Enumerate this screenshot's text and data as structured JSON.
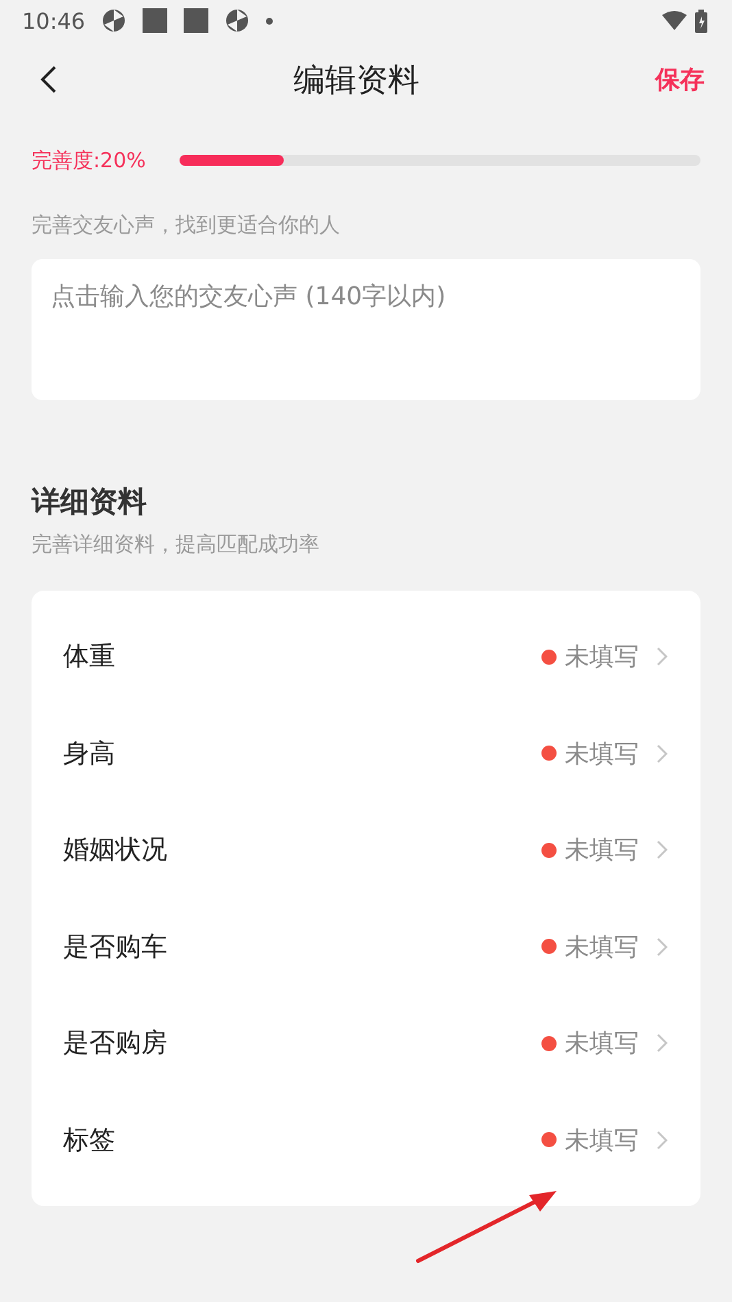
{
  "status_bar": {
    "time": "10:46"
  },
  "header": {
    "title": "编辑资料",
    "action": "保存"
  },
  "completeness": {
    "label": "完善度:20%",
    "level": 0.2
  },
  "intro": {
    "hint": "完善交友心声，找到更适合你的人",
    "placeholder": "点击输入您的交友心声 (140字以内)"
  },
  "details": {
    "title": "详细资料",
    "subtitle": "完善详细资料，提高匹配成功率",
    "items": [
      {
        "label": "体重",
        "value": "未填写",
        "filled": false
      },
      {
        "label": "身高",
        "value": "未填写",
        "filled": false
      },
      {
        "label": "婚姻状况",
        "value": "未填写",
        "filled": false
      },
      {
        "label": "是否购车",
        "value": "未填写",
        "filled": false
      },
      {
        "label": "是否购房",
        "value": "未填写",
        "filled": false
      },
      {
        "label": "标签",
        "value": "未填写",
        "filled": false
      }
    ]
  }
}
